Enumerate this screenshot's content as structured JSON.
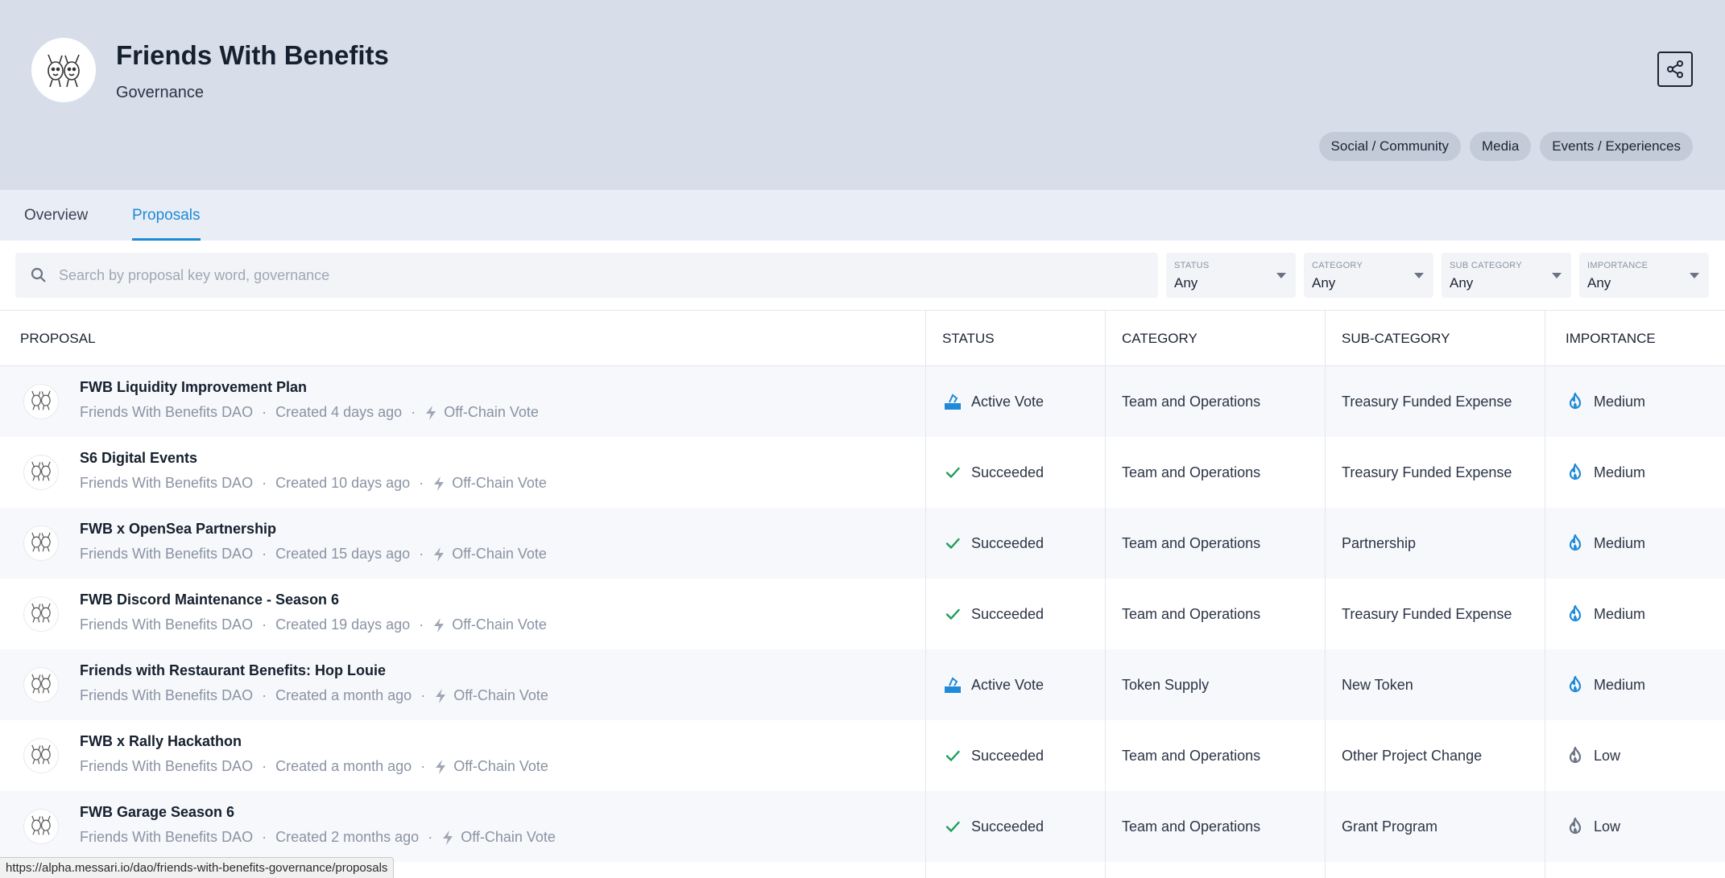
{
  "header": {
    "title": "Friends With Benefits",
    "subtitle": "Governance",
    "avatar_icon": "fwb-logo-icon",
    "share_icon": "share-icon",
    "tags": [
      "Social / Community",
      "Media",
      "Events / Experiences"
    ]
  },
  "tabs": [
    {
      "label": "Overview",
      "active": false
    },
    {
      "label": "Proposals",
      "active": true
    }
  ],
  "filters": {
    "search_placeholder": "Search by proposal key word, governance",
    "status": {
      "label": "STATUS",
      "value": "Any"
    },
    "category": {
      "label": "CATEGORY",
      "value": "Any"
    },
    "sub_category": {
      "label": "SUB CATEGORY",
      "value": "Any"
    },
    "importance": {
      "label": "IMPORTANCE",
      "value": "Any"
    }
  },
  "table": {
    "columns": {
      "proposal": "PROPOSAL",
      "status": "STATUS",
      "category": "CATEGORY",
      "sub_category": "SUB-CATEGORY",
      "importance": "IMPORTANCE"
    },
    "rows": [
      {
        "title": "FWB Liquidity Improvement Plan",
        "dao": "Friends With Benefits DAO",
        "created": "Created 4 days ago",
        "vote_type": "Off-Chain Vote",
        "status": "Active Vote",
        "status_icon": "ballot-box-icon",
        "category": "Team and Operations",
        "sub_category": "Treasury Funded Expense",
        "importance": "Medium",
        "importance_icon": "flame-icon"
      },
      {
        "title": "S6 Digital Events",
        "dao": "Friends With Benefits DAO",
        "created": "Created 10 days ago",
        "vote_type": "Off-Chain Vote",
        "status": "Succeeded",
        "status_icon": "check-icon",
        "category": "Team and Operations",
        "sub_category": "Treasury Funded Expense",
        "importance": "Medium",
        "importance_icon": "flame-icon"
      },
      {
        "title": "FWB x OpenSea Partnership",
        "dao": "Friends With Benefits DAO",
        "created": "Created 15 days ago",
        "vote_type": "Off-Chain Vote",
        "status": "Succeeded",
        "status_icon": "check-icon",
        "category": "Team and Operations",
        "sub_category": "Partnership",
        "importance": "Medium",
        "importance_icon": "flame-icon"
      },
      {
        "title": "FWB Discord Maintenance - Season 6",
        "dao": "Friends With Benefits DAO",
        "created": "Created 19 days ago",
        "vote_type": "Off-Chain Vote",
        "status": "Succeeded",
        "status_icon": "check-icon",
        "category": "Team and Operations",
        "sub_category": "Treasury Funded Expense",
        "importance": "Medium",
        "importance_icon": "flame-icon"
      },
      {
        "title": "Friends with Restaurant Benefits: Hop Louie",
        "dao": "Friends With Benefits DAO",
        "created": "Created a month ago",
        "vote_type": "Off-Chain Vote",
        "status": "Active Vote",
        "status_icon": "ballot-box-icon",
        "category": "Token Supply",
        "sub_category": "New Token",
        "importance": "Medium",
        "importance_icon": "flame-icon"
      },
      {
        "title": "FWB x Rally Hackathon",
        "dao": "Friends With Benefits DAO",
        "created": "Created a month ago",
        "vote_type": "Off-Chain Vote",
        "status": "Succeeded",
        "status_icon": "check-icon",
        "category": "Team and Operations",
        "sub_category": "Other Project Change",
        "importance": "Low",
        "importance_icon": "flame-icon"
      },
      {
        "title": "FWB Garage Season 6",
        "dao": "Friends With Benefits DAO",
        "created": "Created 2 months ago",
        "vote_type": "Off-Chain Vote",
        "status": "Succeeded",
        "status_icon": "check-icon",
        "category": "Team and Operations",
        "sub_category": "Grant Program",
        "importance": "Low",
        "importance_icon": "flame-icon"
      }
    ]
  },
  "colors": {
    "accent": "#1f8ad8",
    "success": "#1e9e5a",
    "medium": "#1f8ad8",
    "low": "#6b7383",
    "header_bg": "#d7deea"
  },
  "status_url": "https://alpha.messari.io/dao/friends-with-benefits-governance/proposals"
}
